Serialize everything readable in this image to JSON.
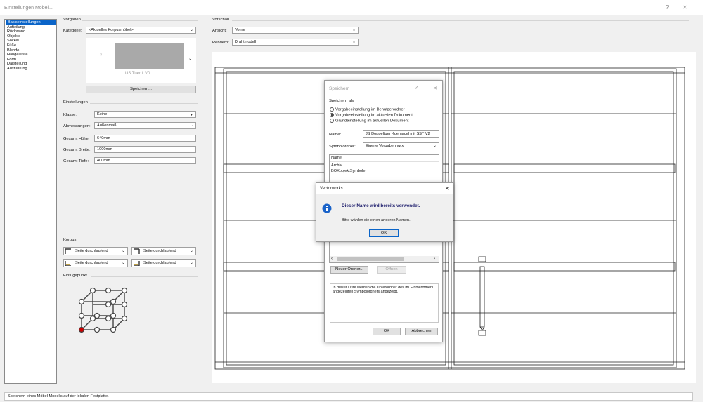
{
  "window": {
    "title": "Einstellungen Möbel...",
    "help_label": "?",
    "close_label": "✕"
  },
  "nav": {
    "items": [
      {
        "label": "Basiseinstellungen",
        "selected": true
      },
      {
        "label": "Aufteilung",
        "selected": false
      },
      {
        "label": "Rückwand",
        "selected": false
      },
      {
        "label": "Objekte",
        "selected": false
      },
      {
        "label": "Sockel",
        "selected": false
      },
      {
        "label": "Füße",
        "selected": false
      },
      {
        "label": "Blende",
        "selected": false
      },
      {
        "label": "Hängeleiste",
        "selected": false
      },
      {
        "label": "Form",
        "selected": false
      },
      {
        "label": "Darstellung",
        "selected": false
      },
      {
        "label": "Ausführung",
        "selected": false
      }
    ]
  },
  "vorgaben": {
    "heading": "Vorgaben",
    "kategorie_label": "Kategorie:",
    "kategorie_value": "<Aktuelles Korpusmöbel>",
    "preview_caption": "US Tuer li V0",
    "save_button": "Speichern..."
  },
  "einstellungen": {
    "heading": "Einstellungen",
    "klasse_label": "Klasse:",
    "klasse_value": "Keine",
    "abmessungen_label": "Abmessungen:",
    "abmessungen_value": "Außenmaß",
    "hoehe_label": "Gesamt Höhe:",
    "hoehe_value": "640mm",
    "breite_label": "Gesamt Breite:",
    "breite_value": "1000mm",
    "tiefe_label": "Gesamt Tiefe:",
    "tiefe_value": "400mm"
  },
  "korpus": {
    "heading": "Korpus",
    "option_label": "Seite durchlaufend"
  },
  "einfuegepunkt": {
    "heading": "Einfügepunkt"
  },
  "vorschau": {
    "heading": "Vorschau",
    "ansicht_label": "Ansicht:",
    "ansicht_value": "Vorne",
    "rendern_label": "Rendern:",
    "rendern_value": "Drahtmodell"
  },
  "speichern_dialog": {
    "title": "Speichern",
    "help_label": "?",
    "close_label": "✕",
    "group_label": "Speichern als",
    "radios": [
      {
        "label": "Vorgabeeinstellung im Benutzerordner",
        "selected": false
      },
      {
        "label": "Vorgabeeinstellung im aktuellen Dokument",
        "selected": true
      },
      {
        "label": "Grundeinstellung im aktuellen Dokument",
        "selected": false
      }
    ],
    "name_label": "Name:",
    "name_value": "JS Doppeltuer Koemacel mit SST V2",
    "ordner_label": "Symbolordner:",
    "ordner_value": "Eigene Vorgaben.vwx",
    "list_header": "Name",
    "list_items": [
      "Archiv",
      "BOXobjektSymbole"
    ],
    "neuer_ordner_button": "Neuer Ordner...",
    "oeffnen_button": "Öffnen",
    "info_text": "In dieser Liste werden die Unterordner des im Einblendmenü angezeigten Symbolordners angezeigt.",
    "ok_button": "OK",
    "cancel_button": "Abbrechen"
  },
  "alert_dialog": {
    "title": "Vectorworks",
    "close_label": "✕",
    "heading": "Dieser Name wird bereits verwendet.",
    "message": "Bitte wählen sie einen anderen Namen.",
    "ok_button": "OK"
  },
  "statusbar": {
    "text": "Speichern eines Möbel Modells auf der lokalen Festplatte."
  },
  "colors": {
    "accent": "#0a64c8",
    "info_icon": "#1a63c9",
    "selected_insert_point": "#cc0000"
  }
}
